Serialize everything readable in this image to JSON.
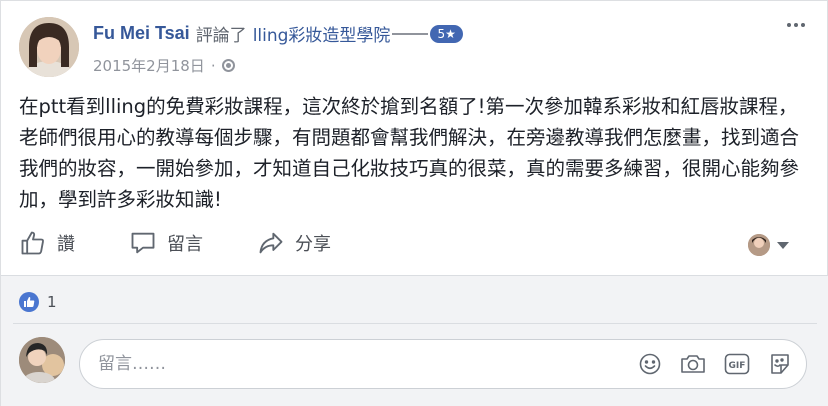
{
  "post": {
    "author": "Fu Mei Tsai",
    "action_text": "評論了",
    "page_name": "lling彩妝造型學院",
    "rating": "5★",
    "date": "2015年2月18日",
    "meta_separator": "·",
    "text": "在ptt看到lling的免費彩妝課程，這次終於搶到名額了!第一次參加韓系彩妝和紅唇妝課程，老師們很用心的教導每個步驟，有問題都會幫我們解決，在旁邊教導我們怎麼畫，找到適合我們的妝容，一開始參加，才知道自己化妝技巧真的很菜，真的需要多練習，很開心能夠參加，學到許多彩妝知識!"
  },
  "actions": {
    "like_label": "讚",
    "comment_label": "留言",
    "share_label": "分享"
  },
  "reactions": {
    "count": "1"
  },
  "comment_composer": {
    "placeholder": "留言……"
  },
  "icons": {
    "more": "more-horizontal-icon",
    "globe": "globe-icon",
    "like": "thumbs-up-icon",
    "comment": "speech-bubble-icon",
    "share": "share-arrow-icon",
    "emoji": "smiley-icon",
    "camera": "camera-icon",
    "gif": "gif-icon",
    "sticker": "sticker-icon"
  },
  "colors": {
    "link_blue": "#365899",
    "badge_blue": "#4267b2",
    "like_blue": "#4a76d0",
    "muted_gray": "#90949c"
  }
}
